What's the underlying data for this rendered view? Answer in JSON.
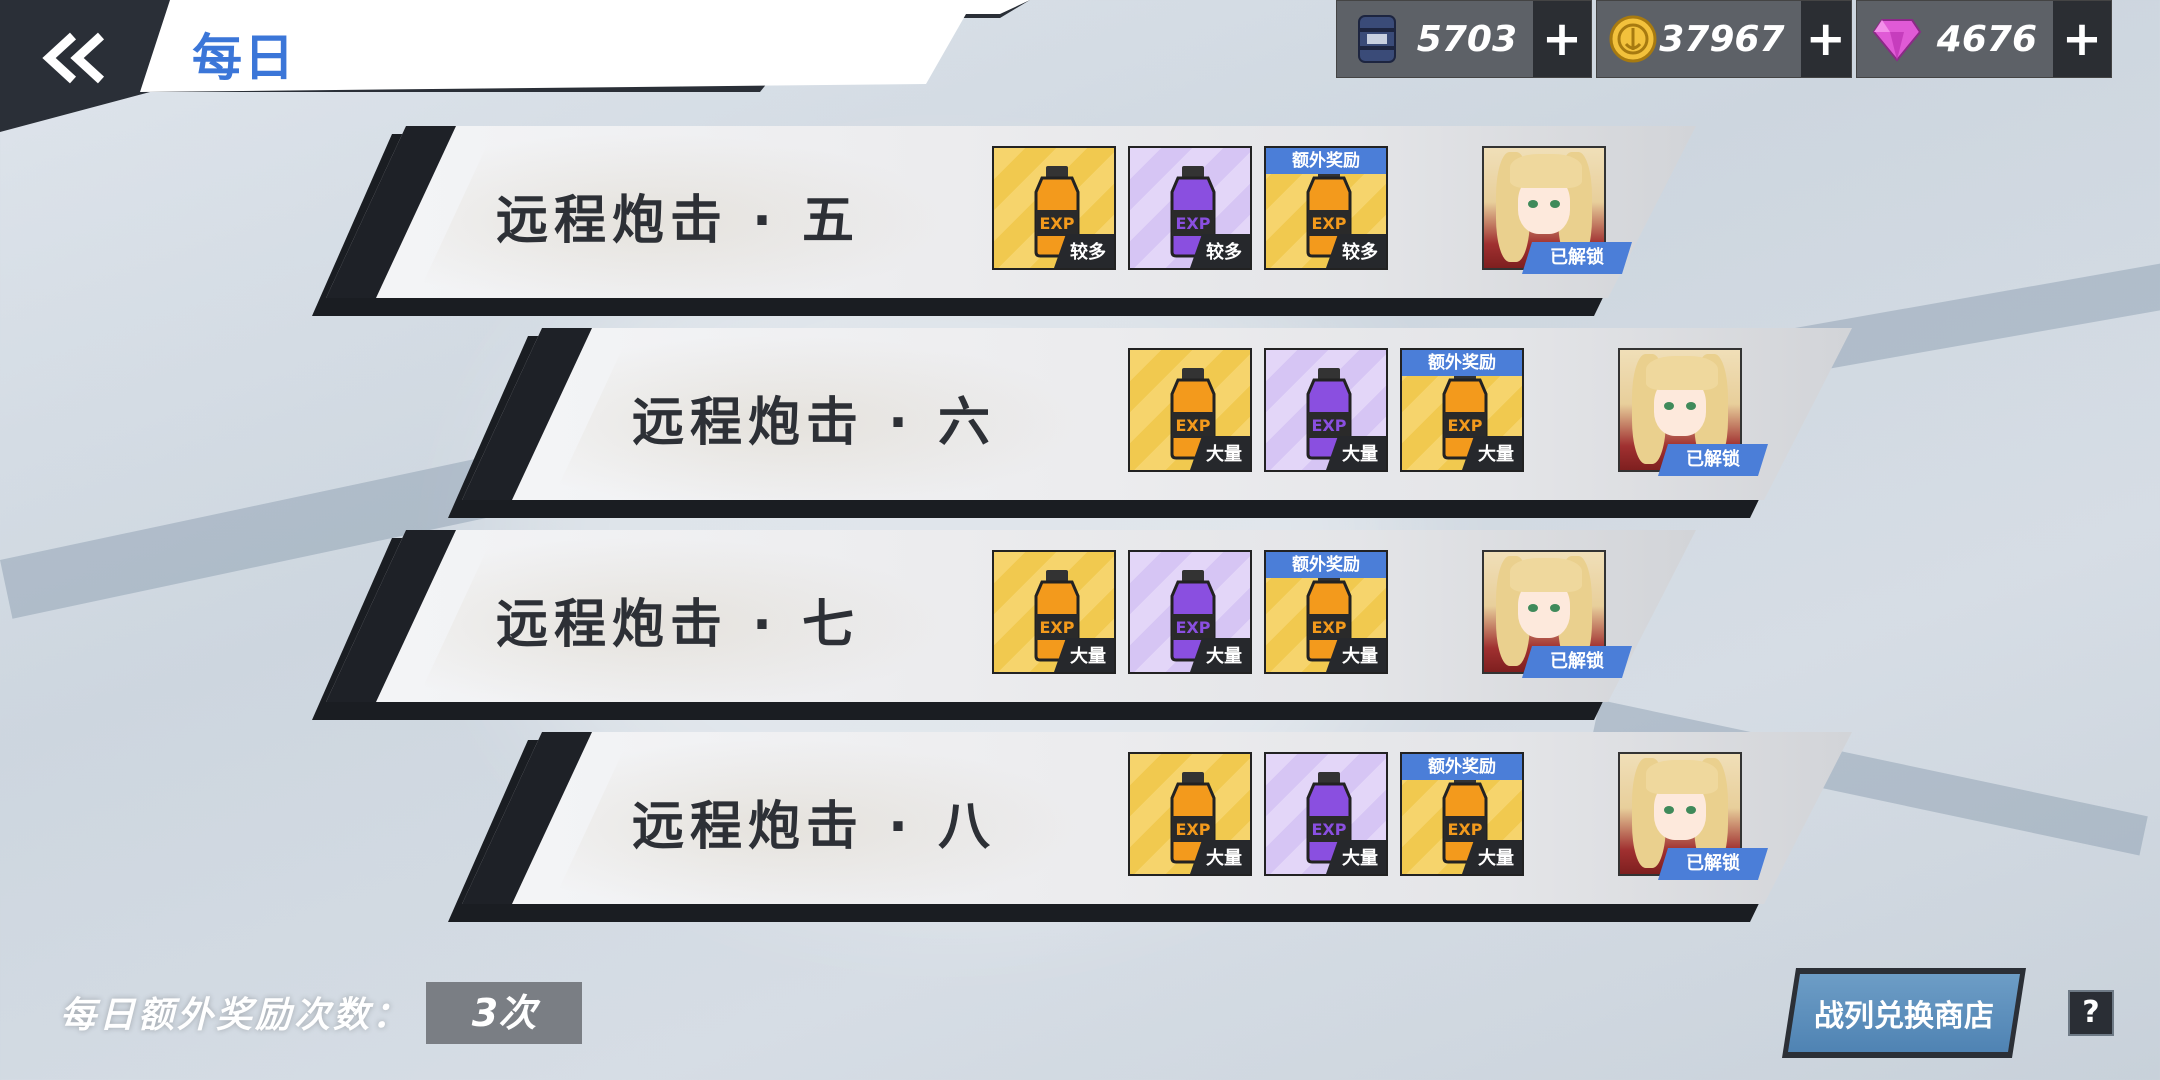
{
  "header": {
    "title": "每日"
  },
  "currencies": [
    {
      "icon": "oil-barrel-icon",
      "value": "5703"
    },
    {
      "icon": "gold-coin-icon",
      "value": "37967"
    },
    {
      "icon": "gem-icon",
      "value": "4676"
    }
  ],
  "plus_label": "+",
  "stages": [
    {
      "name": "远程炮击 · 五",
      "rewards": [
        "较多",
        "较多",
        "较多"
      ],
      "bonus_label": "额外奖励",
      "status": "已解锁"
    },
    {
      "name": "远程炮击 · 六",
      "rewards": [
        "大量",
        "大量",
        "大量"
      ],
      "bonus_label": "额外奖励",
      "status": "已解锁"
    },
    {
      "name": "远程炮击 · 七",
      "rewards": [
        "大量",
        "大量",
        "大量"
      ],
      "bonus_label": "额外奖励",
      "status": "已解锁"
    },
    {
      "name": "远程炮击 · 八",
      "rewards": [
        "大量",
        "大量",
        "大量"
      ],
      "bonus_label": "额外奖励",
      "status": "已解锁"
    }
  ],
  "footer": {
    "bonus_label": "每日额外奖励次数：",
    "bonus_count": "3次",
    "shop_button": "战列兑换商店",
    "help": "?"
  },
  "colors": {
    "accent": "#3b76d8",
    "dark": "#1e2127",
    "bonus_blue": "#4b7ed8"
  }
}
